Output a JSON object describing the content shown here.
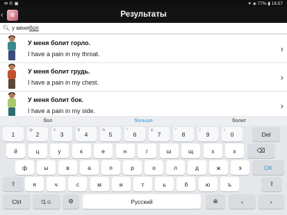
{
  "status": {
    "left_icons": "✉ ✆ ▣",
    "right": "✦ ◈ 77% ▮ 16:57"
  },
  "appbar": {
    "back": "‹",
    "title": "Результаты"
  },
  "search": {
    "prefix": "у меня ",
    "typed": "бол"
  },
  "results": [
    {
      "ru": "У меня болит горло.",
      "en": "I have a pain in my throat.",
      "shirt": "#3c8a8c"
    },
    {
      "ru": "У меня болит грудь.",
      "en": "I have a pain in my chest.",
      "shirt": "#c0532f"
    },
    {
      "ru": "У меня болит бок.",
      "en": "I have a pain in my side.",
      "shirt": "#a8c86b"
    }
  ],
  "suggestions": [
    "бол",
    "больше",
    "болит"
  ],
  "keyboard": {
    "row0": [
      "1",
      "2",
      "3",
      "4",
      "5",
      "6",
      "7",
      "8",
      "9",
      "0",
      "Del"
    ],
    "row0_hints": [
      "`",
      "@",
      "#",
      "$",
      "%",
      "^",
      "&",
      "*",
      "(",
      ")",
      ""
    ],
    "row1": [
      "й",
      "ц",
      "у",
      "к",
      "е",
      "н",
      "г",
      "ш",
      "щ",
      "з",
      "х",
      "⌫"
    ],
    "row2": [
      "ф",
      "ы",
      "в",
      "а",
      "п",
      "р",
      "о",
      "л",
      "д",
      "ж",
      "э",
      "OK"
    ],
    "row3": [
      "⇧",
      "я",
      "ч",
      "с",
      "м",
      "и",
      "т",
      "ь",
      "б",
      "ю",
      "ъ",
      "⇧"
    ],
    "row4": [
      "Ctrl",
      "!1☺",
      "⚙",
      "Русский",
      "⊕",
      "‹",
      "›"
    ]
  }
}
